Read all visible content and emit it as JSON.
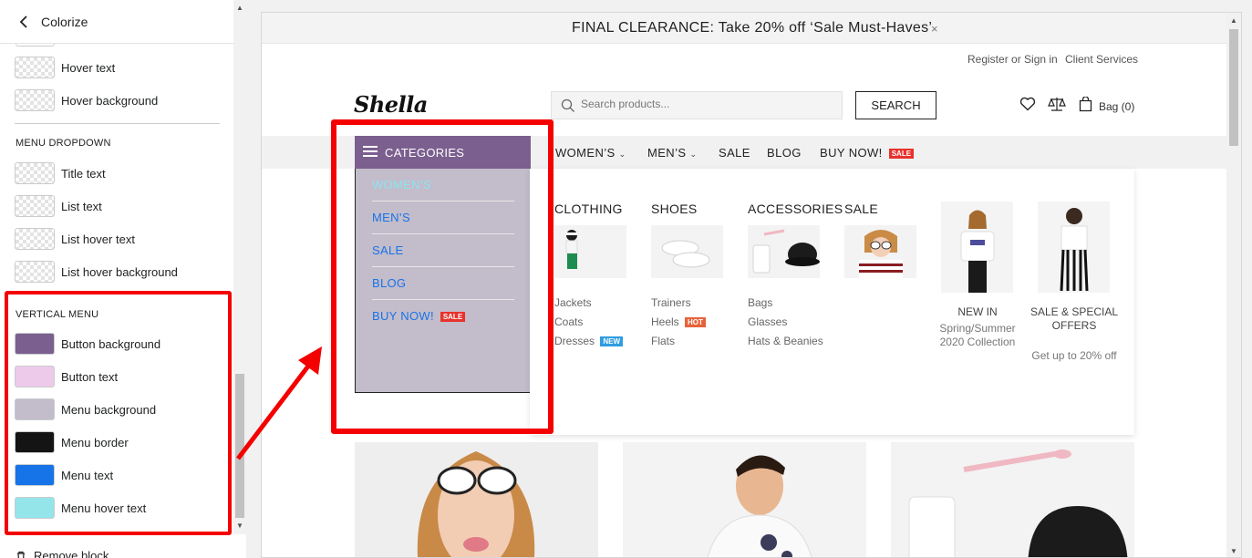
{
  "panel": {
    "title": "Colorize",
    "rows_top": [
      {
        "label": "Hover text",
        "color": "transparent"
      },
      {
        "label": "Hover background",
        "color": "transparent"
      }
    ],
    "menu_dropdown": {
      "heading": "MENU DROPDOWN",
      "rows": [
        {
          "label": "Title text",
          "color": "transparent"
        },
        {
          "label": "List text",
          "color": "transparent"
        },
        {
          "label": "List hover text",
          "color": "transparent"
        },
        {
          "label": "List hover background",
          "color": "transparent"
        }
      ]
    },
    "vertical_menu": {
      "heading": "VERTICAL MENU",
      "rows": [
        {
          "label": "Button background",
          "color": "#7b5f8f"
        },
        {
          "label": "Button text",
          "color": "#edc9ea"
        },
        {
          "label": "Menu background",
          "color": "#c2bccb"
        },
        {
          "label": "Menu border",
          "color": "#141414"
        },
        {
          "label": "Menu text",
          "color": "#1773e8"
        },
        {
          "label": "Menu hover text",
          "color": "#94e5ea"
        }
      ]
    },
    "remove_block": "Remove block"
  },
  "store": {
    "announcement": "FINAL CLEARANCE: Take 20% off ‘Sale Must-Haves’",
    "announcement_close": "×",
    "top_links": {
      "register": "Register or Sign in",
      "services": "Client Services"
    },
    "logo": "Shella",
    "search": {
      "placeholder": "Search products...",
      "button": "SEARCH"
    },
    "bag": "Bag (0)",
    "nav": {
      "categories": "CATEGORIES",
      "items": [
        {
          "label": "WOMEN’S",
          "dropdown": true
        },
        {
          "label": "MEN’S",
          "dropdown": true
        },
        {
          "label": "SALE"
        },
        {
          "label": "BLOG"
        },
        {
          "label": "BUY NOW!",
          "badge": "SALE"
        }
      ]
    },
    "vertical_menu": {
      "items": [
        {
          "label": "WOMEN’S",
          "state": "hover"
        },
        {
          "label": "MEN’S"
        },
        {
          "label": "SALE"
        },
        {
          "label": "BLOG"
        },
        {
          "label": "BUY NOW!",
          "badge": "SALE"
        }
      ]
    },
    "mega": {
      "columns": [
        {
          "title": "CLOTHING",
          "links": [
            {
              "label": "Jackets"
            },
            {
              "label": "Coats"
            },
            {
              "label": "Dresses",
              "badge": "NEW"
            }
          ]
        },
        {
          "title": "SHOES",
          "links": [
            {
              "label": "Trainers"
            },
            {
              "label": "Heels",
              "badge": "HOT"
            },
            {
              "label": "Flats"
            }
          ]
        },
        {
          "title": "ACCESSORIES",
          "links": [
            {
              "label": "Bags"
            },
            {
              "label": "Glasses"
            },
            {
              "label": "Hats & Beanies"
            }
          ]
        },
        {
          "title": "SALE",
          "links": []
        }
      ],
      "promos": [
        {
          "title": "NEW IN",
          "subtitle": "Spring/Summer 2020 Collection"
        },
        {
          "title": "SALE & SPECIAL OFFERS",
          "subtitle": "Get up to 20% off"
        }
      ]
    },
    "badge_colors": {
      "SALE": "#e8322c",
      "NEW": "#2f9de0",
      "HOT": "#e8633a"
    }
  },
  "icons": [
    "back-icon",
    "search-icon",
    "heart-icon",
    "compare-icon",
    "bag-icon",
    "close-icon",
    "chevron-down-icon",
    "menu-icon",
    "trash-icon"
  ]
}
